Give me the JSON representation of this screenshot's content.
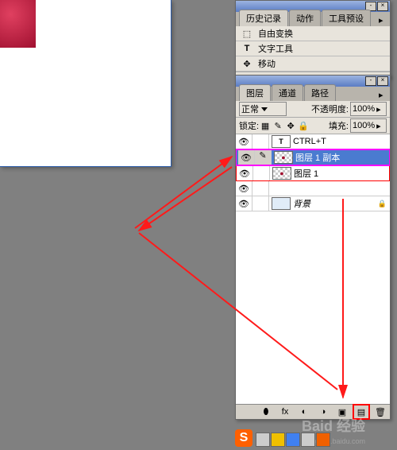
{
  "history_panel": {
    "tabs": [
      "历史记录",
      "动作",
      "工具预设"
    ],
    "items": [
      {
        "icon": "free-transform-icon",
        "label": "自由变换"
      },
      {
        "icon": "text-tool-icon",
        "label": "文字工具"
      },
      {
        "icon": "move-tool-icon",
        "label": "移动"
      }
    ]
  },
  "layers_panel": {
    "tabs": [
      "图层",
      "通道",
      "路径"
    ],
    "blend_mode": "正常",
    "opacity_label": "不透明度:",
    "opacity_value": "100%",
    "lock_label": "锁定:",
    "fill_label": "填充:",
    "fill_value": "100%",
    "layers": [
      {
        "name": "CTRL+T",
        "type": "text"
      },
      {
        "name": "图层 1 副本",
        "type": "normal",
        "selected": true,
        "redbox": true,
        "magenta": true
      },
      {
        "name": "图层 1",
        "type": "normal",
        "redbox": true
      },
      {
        "name": "",
        "type": "spacer"
      },
      {
        "name": "背景",
        "type": "bg",
        "locked": true
      }
    ]
  },
  "watermark": {
    "main": "Baid 经验",
    "sub": "jingyan.baidu.com"
  },
  "logo": "S"
}
